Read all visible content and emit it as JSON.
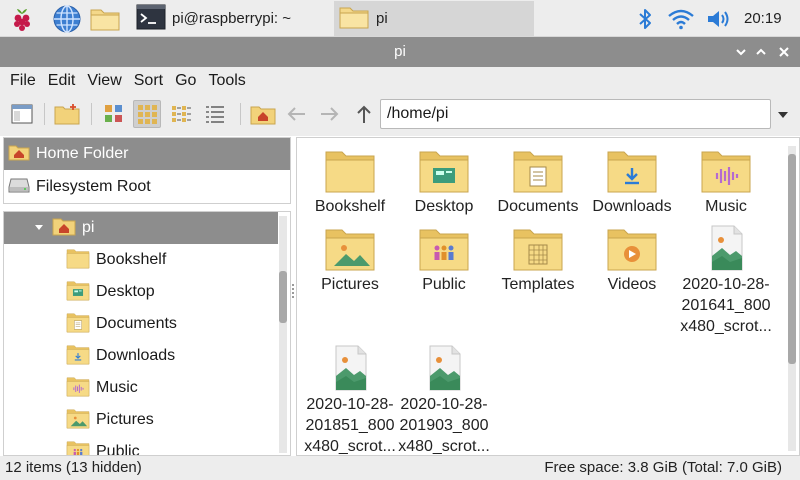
{
  "taskbar": {
    "launchers": [
      "raspberry-menu-icon",
      "web-browser-icon",
      "file-manager-icon"
    ],
    "tasks": [
      {
        "label": "pi@raspberrypi: ~",
        "icon": "terminal-icon"
      },
      {
        "label": "pi",
        "icon": "folder-icon",
        "active": true
      }
    ],
    "tray": [
      "bluetooth-icon",
      "wifi-icon",
      "volume-icon"
    ],
    "clock": "20:19"
  },
  "window": {
    "title": "pi"
  },
  "menu": [
    "File",
    "Edit",
    "View",
    "Sort",
    "Go",
    "Tools"
  ],
  "toolbar": {
    "path": "/home/pi",
    "buttons": [
      "new-window-icon",
      "new-folder-icon",
      "thumbnail-view-icon",
      "icon-view-icon",
      "compact-view-icon",
      "list-view-icon",
      "home-icon",
      "back-arrow-icon",
      "forward-arrow-icon",
      "up-arrow-icon"
    ]
  },
  "sidebar": {
    "places": [
      {
        "label": "Home Folder",
        "selected": true
      },
      {
        "label": "Filesystem Root",
        "selected": false
      }
    ],
    "tree": [
      {
        "label": "pi",
        "selected": true
      },
      {
        "label": "Bookshelf"
      },
      {
        "label": "Desktop"
      },
      {
        "label": "Documents"
      },
      {
        "label": "Downloads"
      },
      {
        "label": "Music"
      },
      {
        "label": "Pictures"
      },
      {
        "label": "Public"
      }
    ]
  },
  "files": [
    {
      "name": "Bookshelf",
      "type": "folder"
    },
    {
      "name": "Desktop",
      "type": "folder-desktop"
    },
    {
      "name": "Documents",
      "type": "folder-documents"
    },
    {
      "name": "Downloads",
      "type": "folder-downloads"
    },
    {
      "name": "Music",
      "type": "folder-music"
    },
    {
      "name": "Pictures",
      "type": "folder-pictures"
    },
    {
      "name": "Public",
      "type": "folder-public"
    },
    {
      "name": "Templates",
      "type": "folder-templates"
    },
    {
      "name": "Videos",
      "type": "folder-videos"
    },
    {
      "name": "2020-10-28-201641_800x480_scrot...",
      "type": "image"
    },
    {
      "name": "2020-10-28-201851_800x480_scrot...",
      "type": "image"
    },
    {
      "name": "2020-10-28-201903_800x480_scrot...",
      "type": "image"
    }
  ],
  "status": {
    "items": "12 items (13 hidden)",
    "space": "Free space: 3.8 GiB (Total: 7.0 GiB)"
  },
  "colors": {
    "folder": "#f2d27a",
    "folder_dark": "#e0b552",
    "selection": "#8d8d8d",
    "accent_blue": "#2b7bd6"
  }
}
